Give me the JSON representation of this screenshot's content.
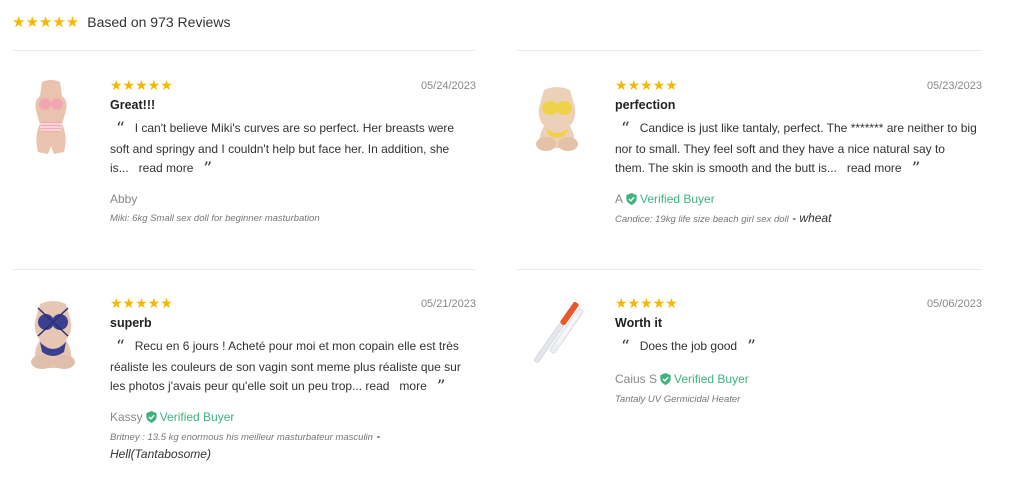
{
  "summary": {
    "stars": "★★★★★",
    "text": "Based on 973 Reviews"
  },
  "reviews": [
    {
      "stars": "★★★★★",
      "date": "05/24/2023",
      "title": "Great!!!",
      "text": "I can't believe Miki's curves are so perfect. Her breasts were soft and springy and I couldn't help but face her. In addition, she is...",
      "read_more": "read more",
      "author": "Abby",
      "verified": "",
      "product": "Miki: 6kg Small sex doll for beginner masturbation",
      "variant": "",
      "thumb_icon": "product-thumbnail-icon"
    },
    {
      "stars": "★★★★★",
      "date": "05/23/2023",
      "title": "perfection",
      "text": "Candice is just like tantaly, perfect. The ******* are neither to big nor to small. They feel soft and they have a nice natural say to them. The skin is smooth and the butt is...",
      "read_more": "read more",
      "author": "A",
      "verified": "Verified Buyer",
      "product": "Candice: 19kg life size beach girl sex doll",
      "variant": " - wheat",
      "thumb_icon": "product-thumbnail-icon"
    },
    {
      "stars": "★★★★★",
      "date": "05/21/2023",
      "title": "superb",
      "text": "Recu en 6 jours ! Acheté pour moi et mon copain elle est très réaliste les couleurs de son vagin sont meme plus réaliste que sur les photos j'avais peur qu'elle soit un peu trop... read",
      "read_more": "more",
      "author": "Kassy",
      "verified": "Verified Buyer",
      "product": "Britney : 13.5 kg enormous his meilleur masturbateur masculin",
      "variant": " - Hell(Tantabosome)",
      "thumb_icon": "product-thumbnail-icon"
    },
    {
      "stars": "★★★★★",
      "date": "05/06/2023",
      "title": "Worth it",
      "text": "Does the job good",
      "read_more": "",
      "author": "Caius S",
      "verified": "Verified Buyer",
      "product": "Tantaly UV Germicidal Heater",
      "variant": "",
      "thumb_icon": "uv-wand-icon"
    }
  ],
  "colors": {
    "star": "#f5b700",
    "verified": "#3fb27f",
    "divider": "#ececec"
  }
}
